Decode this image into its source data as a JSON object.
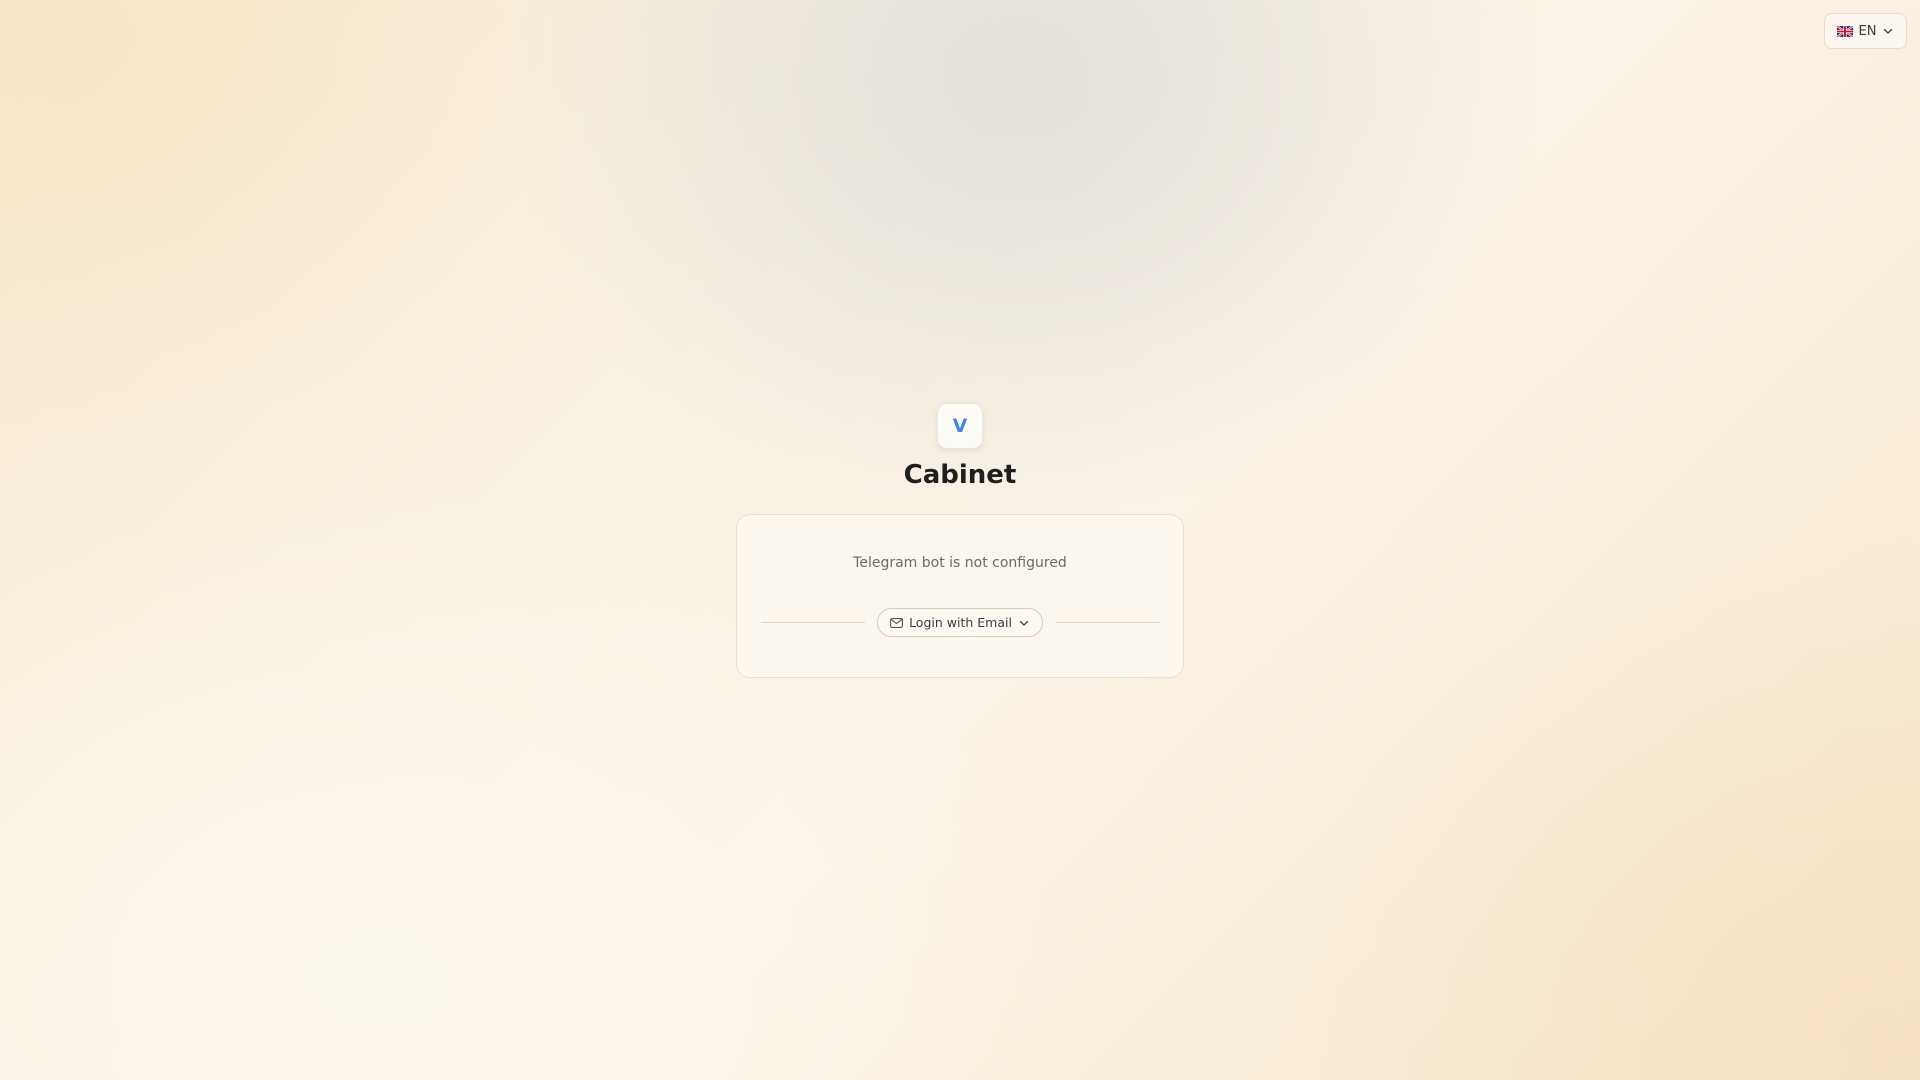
{
  "language_switcher": {
    "flag_icon": "uk-flag-icon",
    "label": "EN",
    "caret_icon": "chevron-down-icon"
  },
  "brand": {
    "logo_letter": "V",
    "logo_color": "#4a86d8",
    "title": "Cabinet"
  },
  "login_card": {
    "status_message": "Telegram bot is not configured",
    "email_login": {
      "icon": "mail-icon",
      "label": "Login with Email",
      "caret_icon": "chevron-down-icon"
    }
  }
}
